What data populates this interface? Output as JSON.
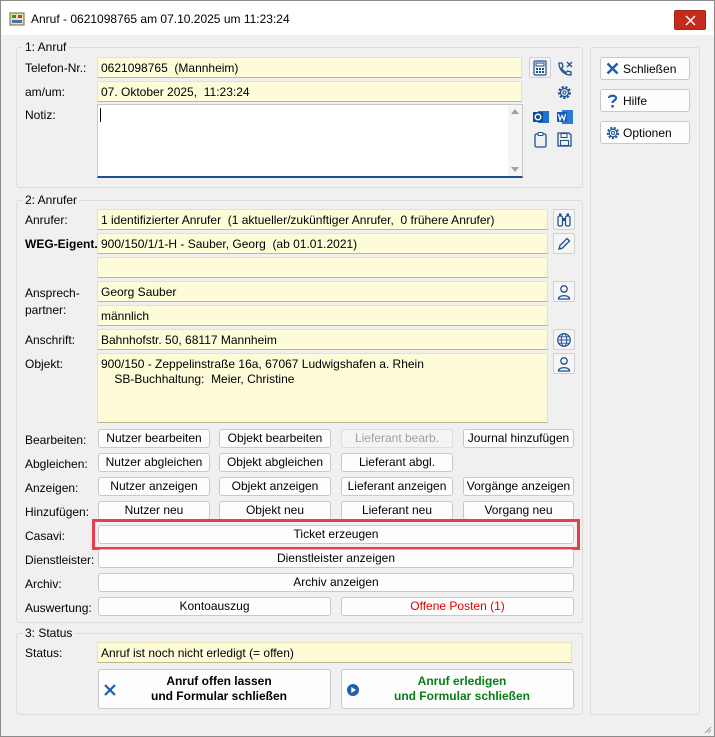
{
  "window": {
    "title": "Anruf - 0621098765 am 07.10.2025 um 11:23:24"
  },
  "section1": {
    "title": "1: Anruf",
    "phone_label": "Telefon-Nr.:",
    "phone_value": "0621098765  (Mannheim)",
    "date_label": "am/um:",
    "date_value": "07. Oktober 2025,  11:23:24",
    "note_label": "Notiz:",
    "note_value": ""
  },
  "section2": {
    "title": "2: Anrufer",
    "caller_label": "Anrufer:",
    "caller_value": "1 identifizierter Anrufer  (1 aktueller/zukünftiger Anrufer,  0 frühere Anrufer)",
    "owner_label": "WEG-Eigent.:",
    "owner_value": "900/150/1/1-H - Sauber, Georg  (ab 01.01.2021)",
    "owner_value2": "",
    "contact_label": "Ansprech-\npartner:",
    "contact_name": "Georg Sauber",
    "contact_gender": "männlich",
    "address_label": "Anschrift:",
    "address_value": "Bahnhofstr. 50, 68117 Mannheim",
    "object_label": "Objekt:",
    "object_value": "900/150 - Zeppelinstraße 16a, 67067 Ludwigshafen a. Rhein\n    SB-Buchhaltung:  Meier, Christine"
  },
  "actions": {
    "edit_label": "Bearbeiten:",
    "edit_user": "Nutzer bearbeiten",
    "edit_object": "Objekt bearbeiten",
    "edit_supplier": "Lieferant bearb.",
    "edit_journal": "Journal hinzufügen",
    "sync_label": "Abgleichen:",
    "sync_user": "Nutzer abgleichen",
    "sync_object": "Objekt abgleichen",
    "sync_supplier": "Lieferant abgl.",
    "show_label": "Anzeigen:",
    "show_user": "Nutzer anzeigen",
    "show_object": "Objekt anzeigen",
    "show_supplier": "Lieferant anzeigen",
    "show_processes": "Vorgänge anzeigen",
    "add_label": "Hinzufügen:",
    "add_user": "Nutzer neu",
    "add_object": "Objekt neu",
    "add_supplier": "Lieferant neu",
    "add_process": "Vorgang neu",
    "casavi_label": "Casavi:",
    "casavi_ticket": "Ticket erzeugen",
    "provider_label": "Dienstleister:",
    "provider_show": "Dienstleister anzeigen",
    "archive_label": "Archiv:",
    "archive_show": "Archiv anzeigen",
    "eval_label": "Auswertung:",
    "eval_statement": "Kontoauszug",
    "eval_open": "Offene Posten (1)"
  },
  "section3": {
    "title": "3: Status",
    "status_label": "Status:",
    "status_value": "Anruf ist noch nicht erledigt (= offen)",
    "leave_open": "Anruf offen lassen\nund Formular schließen",
    "complete": "Anruf erledigen\nund Formular schließen"
  },
  "side": {
    "close": "Schließen",
    "help": "Hilfe",
    "options": "Optionen"
  },
  "colors": {
    "field_bg": "#fdfbd8",
    "highlight": "#ec3b4d",
    "accent": "#1e5fb0",
    "green": "#0a7d16",
    "red": "#e00000"
  },
  "icons": [
    "calculator-icon",
    "phone-missed-icon",
    "gear-icon",
    "outlook-icon",
    "word-icon",
    "clipboard-icon",
    "save-icon",
    "binoculars-icon",
    "pencil-icon",
    "person-icon",
    "globe-icon"
  ]
}
